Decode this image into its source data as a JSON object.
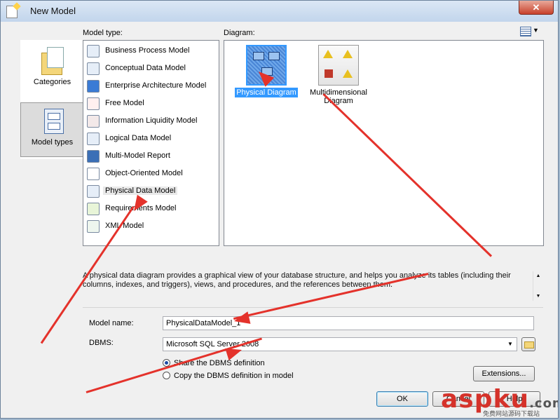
{
  "window": {
    "title": "New Model",
    "close_label": "✕"
  },
  "labels": {
    "model_type": "Model type:",
    "diagram": "Diagram:"
  },
  "categories": [
    {
      "label": "Categories",
      "selected": false
    },
    {
      "label": "Model types",
      "selected": true
    }
  ],
  "model_types": [
    {
      "label": "Business Process Model",
      "icon": "business-process-icon"
    },
    {
      "label": "Conceptual Data Model",
      "icon": "conceptual-data-icon"
    },
    {
      "label": "Enterprise Architecture Model",
      "icon": "enterprise-architecture-icon"
    },
    {
      "label": "Free Model",
      "icon": "free-model-icon"
    },
    {
      "label": "Information Liquidity Model",
      "icon": "information-liquidity-icon"
    },
    {
      "label": "Logical Data Model",
      "icon": "logical-data-icon"
    },
    {
      "label": "Multi-Model Report",
      "icon": "multi-model-report-icon"
    },
    {
      "label": "Object-Oriented Model",
      "icon": "object-oriented-icon"
    },
    {
      "label": "Physical Data Model",
      "icon": "physical-data-icon",
      "selected": true
    },
    {
      "label": "Requirements Model",
      "icon": "requirements-icon"
    },
    {
      "label": "XML Model",
      "icon": "xml-model-icon"
    }
  ],
  "diagrams": [
    {
      "label": "Physical Diagram",
      "selected": true
    },
    {
      "label": "Multidimensional\nDiagram",
      "selected": false
    }
  ],
  "description": "A physical data diagram provides a graphical view of your database structure, and helps you analyze its tables (including their columns, indexes, and triggers), views, and procedures, and the references between them.",
  "form": {
    "model_name_label": "Model name:",
    "model_name_value": "PhysicalDataModel_1",
    "dbms_label": "DBMS:",
    "dbms_value": "Microsoft SQL Server 2008",
    "share_label": "Share the DBMS definition",
    "copy_label": "Copy the DBMS definition in model",
    "extensions_label": "Extensions..."
  },
  "buttons": {
    "ok": "OK",
    "cancel": "Cancel",
    "help": "Help"
  },
  "watermark": {
    "main": "aspku",
    "dot": ".com",
    "sub": "免费网站源码下载站"
  },
  "colors": {
    "accent_red": "#e4322b",
    "selection_blue": "#3399ff"
  }
}
